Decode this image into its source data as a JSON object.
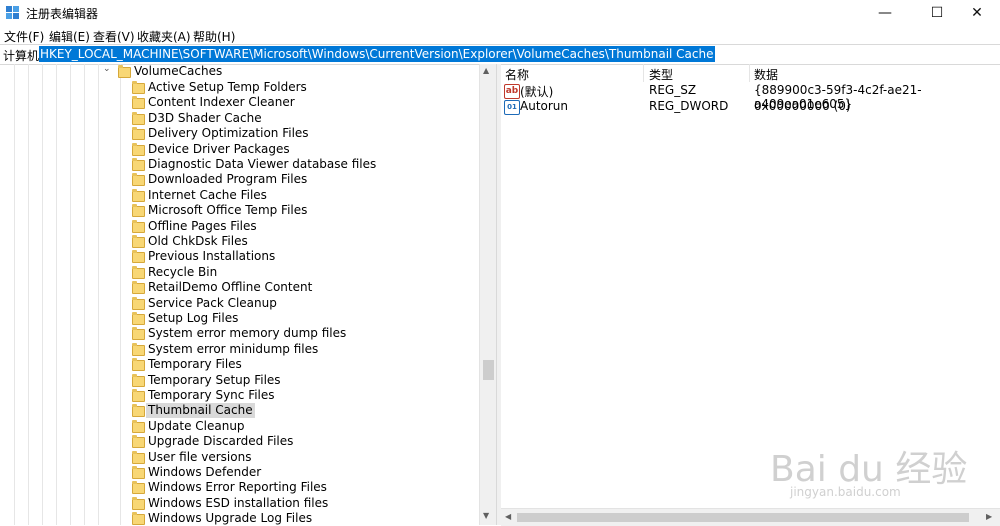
{
  "window": {
    "title": "注册表编辑器",
    "minimize": "—",
    "maximize": "☐",
    "close": "✕"
  },
  "menu": [
    "文件(F)",
    "编辑(E)",
    "查看(V)",
    "收藏夹(A)",
    "帮助(H)"
  ],
  "address": {
    "label": "计算机\\",
    "path": "HKEY_LOCAL_MACHINE\\SOFTWARE\\Microsoft\\Windows\\CurrentVersion\\Explorer\\VolumeCaches\\Thumbnail Cache"
  },
  "tree": {
    "parent": "VolumeCaches",
    "children": [
      "Active Setup Temp Folders",
      "Content Indexer Cleaner",
      "D3D Shader Cache",
      "Delivery Optimization Files",
      "Device Driver Packages",
      "Diagnostic Data Viewer database files",
      "Downloaded Program Files",
      "Internet Cache Files",
      "Microsoft Office Temp Files",
      "Offline Pages Files",
      "Old ChkDsk Files",
      "Previous Installations",
      "Recycle Bin",
      "RetailDemo Offline Content",
      "Service Pack Cleanup",
      "Setup Log Files",
      "System error memory dump files",
      "System error minidump files",
      "Temporary Files",
      "Temporary Setup Files",
      "Temporary Sync Files",
      "Thumbnail Cache",
      "Update Cleanup",
      "Upgrade Discarded Files",
      "User file versions",
      "Windows Defender",
      "Windows Error Reporting Files",
      "Windows ESD installation files",
      "Windows Upgrade Log Files"
    ],
    "selected": "Thumbnail Cache"
  },
  "values": {
    "headers": [
      "名称",
      "类型",
      "数据"
    ],
    "rows": [
      {
        "icon": "string-value-icon",
        "name": "(默认)",
        "type": "REG_SZ",
        "data": "{889900c3-59f3-4c2f-ae21-a409ea01e605}"
      },
      {
        "icon": "dword-value-icon",
        "name": "Autorun",
        "type": "REG_DWORD",
        "data": "0x00000000 (0)"
      }
    ]
  },
  "watermark": {
    "text": "Bai du 经验",
    "url": "jingyan.baidu.com"
  },
  "colors": {
    "selection": "#0078d7",
    "folder": "#f8d775"
  }
}
